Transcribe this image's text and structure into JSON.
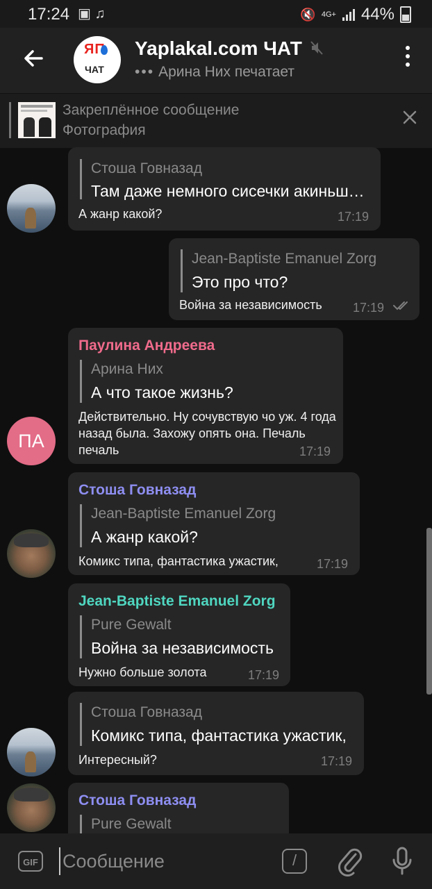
{
  "status_bar": {
    "time": "17:24",
    "left_icons": "▣ ♫",
    "network": "4G+",
    "battery": "44%"
  },
  "header": {
    "title": "Yaplakal.com ЧАТ",
    "logo_top": "ЯП",
    "logo_bottom": "ЧАТ",
    "typing_dots": "•••",
    "typing_status": "Арина Них печатает"
  },
  "pinned": {
    "label": "Закреплённое сообщение",
    "value": "Фотография"
  },
  "messages": [
    {
      "reply_name": "Стоша Говназад",
      "reply_text": "Там даже немного сисечки акиньш…",
      "text": "А жанр какой?",
      "time": "17:19"
    },
    {
      "reply_name": "Jean-Baptiste Emanuel Zorg",
      "reply_text": "Это про что?",
      "text": "Война за независимость",
      "time": "17:19",
      "outgoing": true
    },
    {
      "sender": "Паулина Андреева",
      "reply_name": "Арина Них",
      "reply_text": "А что такое жизнь?",
      "text": "Действительно. Ну сочувствую чо уж. 4 года назад была. Захожу опять она. Печаль печаль",
      "time": "17:19",
      "avatar_initials": "ПА"
    },
    {
      "sender": "Стоша Говназад",
      "reply_name": "Jean-Baptiste Emanuel Zorg",
      "reply_text": "А жанр какой?",
      "text": "Комикс типа, фантастика ужастик,",
      "time": "17:19"
    },
    {
      "sender": "Jean-Baptiste Emanuel Zorg",
      "reply_name": "Pure Gewalt",
      "reply_text": "Война за независимость",
      "text": "Нужно больше золота",
      "time": "17:19"
    },
    {
      "reply_name": "Стоша Говназад",
      "reply_text": "Комикс типа, фантастика ужастик,",
      "text": "Интересный?",
      "time": "17:19"
    },
    {
      "sender": "Стоша Говназад",
      "reply_name": "Pure Gewalt"
    }
  ],
  "colors": {
    "sender_pink": "#f06b8c",
    "sender_violet": "#8e8ef2",
    "sender_teal": "#4fd6c0",
    "bubble": "#262626",
    "background": "#0f0f0f"
  },
  "input": {
    "placeholder": "Сообщение",
    "gif_label": "GIF",
    "command_label": "/"
  }
}
